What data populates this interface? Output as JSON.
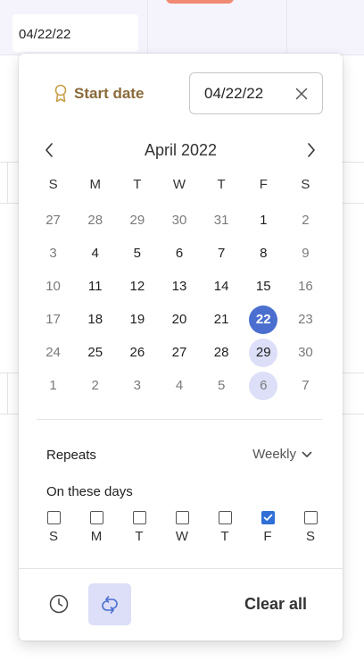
{
  "background": {
    "cell_value": "04/22/22"
  },
  "picker": {
    "start_label": "Start date",
    "icons": {
      "start": "ribbon-icon",
      "clear": "close-icon",
      "prev": "chevron-left-icon",
      "next": "chevron-right-icon",
      "dropdown": "chevron-down-icon",
      "clock": "clock-icon",
      "repeat": "repeat-icon",
      "check": "checkmark-icon"
    },
    "date_value": "04/22/22",
    "month_title": "April 2022",
    "weekday_headers": [
      "S",
      "M",
      "T",
      "W",
      "T",
      "F",
      "S"
    ],
    "weeks": [
      [
        {
          "d": "27",
          "state": "other"
        },
        {
          "d": "28",
          "state": "other"
        },
        {
          "d": "29",
          "state": "other"
        },
        {
          "d": "30",
          "state": "other"
        },
        {
          "d": "31",
          "state": "other"
        },
        {
          "d": "1",
          "state": "current"
        },
        {
          "d": "2",
          "state": "other"
        }
      ],
      [
        {
          "d": "3",
          "state": "other"
        },
        {
          "d": "4",
          "state": "current"
        },
        {
          "d": "5",
          "state": "current"
        },
        {
          "d": "6",
          "state": "current"
        },
        {
          "d": "7",
          "state": "current"
        },
        {
          "d": "8",
          "state": "current"
        },
        {
          "d": "9",
          "state": "other"
        }
      ],
      [
        {
          "d": "10",
          "state": "other"
        },
        {
          "d": "11",
          "state": "current"
        },
        {
          "d": "12",
          "state": "current"
        },
        {
          "d": "13",
          "state": "current"
        },
        {
          "d": "14",
          "state": "current"
        },
        {
          "d": "15",
          "state": "current"
        },
        {
          "d": "16",
          "state": "other"
        }
      ],
      [
        {
          "d": "17",
          "state": "other"
        },
        {
          "d": "18",
          "state": "current"
        },
        {
          "d": "19",
          "state": "current"
        },
        {
          "d": "20",
          "state": "current"
        },
        {
          "d": "21",
          "state": "current"
        },
        {
          "d": "22",
          "state": "selected"
        },
        {
          "d": "23",
          "state": "other"
        }
      ],
      [
        {
          "d": "24",
          "state": "other"
        },
        {
          "d": "25",
          "state": "current"
        },
        {
          "d": "26",
          "state": "current"
        },
        {
          "d": "27",
          "state": "current"
        },
        {
          "d": "28",
          "state": "current"
        },
        {
          "d": "29",
          "state": "inrange"
        },
        {
          "d": "30",
          "state": "other"
        }
      ],
      [
        {
          "d": "1",
          "state": "other"
        },
        {
          "d": "2",
          "state": "other"
        },
        {
          "d": "3",
          "state": "other"
        },
        {
          "d": "4",
          "state": "other"
        },
        {
          "d": "5",
          "state": "other"
        },
        {
          "d": "6",
          "state": "inrange-other"
        },
        {
          "d": "7",
          "state": "other"
        }
      ]
    ],
    "repeats_label": "Repeats",
    "repeats_value": "Weekly",
    "days_label": "On these days",
    "repeat_days": [
      {
        "letter": "S",
        "checked": false
      },
      {
        "letter": "M",
        "checked": false
      },
      {
        "letter": "T",
        "checked": false
      },
      {
        "letter": "W",
        "checked": false
      },
      {
        "letter": "T",
        "checked": false
      },
      {
        "letter": "F",
        "checked": true
      },
      {
        "letter": "S",
        "checked": false
      }
    ],
    "clear_all_label": "Clear all"
  },
  "colors": {
    "accent": "#4a6fcf",
    "accent_light": "#dcdff7",
    "checkbox_accent": "#2f6fd6",
    "start_label": "#8a6a3a"
  }
}
